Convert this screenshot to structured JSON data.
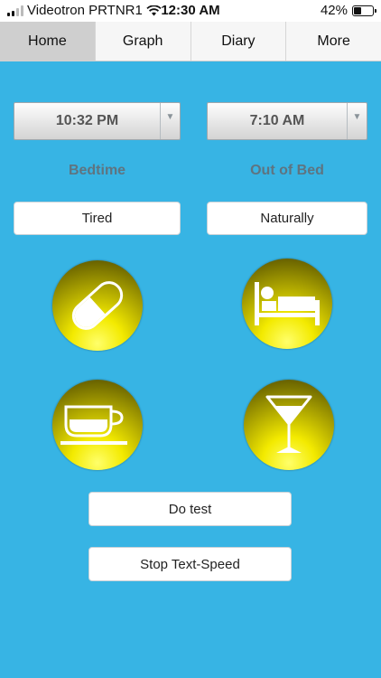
{
  "status_bar": {
    "carrier": "Videotron PRTNR1",
    "time": "12:30 AM",
    "battery_percent": "42%",
    "battery_level": 0.42
  },
  "tabs": [
    {
      "label": "Home",
      "active": true
    },
    {
      "label": "Graph",
      "active": false
    },
    {
      "label": "Diary",
      "active": false
    },
    {
      "label": "More",
      "active": false
    }
  ],
  "bedtime": {
    "value": "10:32 PM",
    "label": "Bedtime",
    "feeling": "Tired"
  },
  "out_of_bed": {
    "value": "7:10 AM",
    "label": "Out of Bed",
    "wake_reason": "Naturally"
  },
  "icon_buttons": [
    {
      "icon": "pill-icon"
    },
    {
      "icon": "bed-icon"
    },
    {
      "icon": "coffee-cup-icon"
    },
    {
      "icon": "cocktail-glass-icon"
    }
  ],
  "actions": {
    "do_test": "Do test",
    "stop_text_speed": "Stop Text-Speed"
  },
  "colors": {
    "background": "#37b4e4",
    "orb_yellow": "#f3ea00",
    "label_text": "#5f7480"
  }
}
